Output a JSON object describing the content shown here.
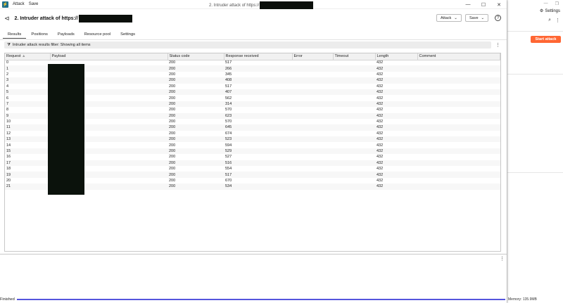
{
  "window": {
    "menu": [
      "Attack",
      "Save"
    ],
    "title_prefix": "2. Intruder attack of https://",
    "controls": [
      "—",
      "☐",
      "✕"
    ]
  },
  "header": {
    "title_prefix": "2. Intruder attack of https://",
    "attack_button": "Attack",
    "save_button": "Save",
    "help": "?"
  },
  "tabs": [
    "Results",
    "Positions",
    "Payloads",
    "Resource pool",
    "Settings"
  ],
  "active_tab": "Results",
  "filter": {
    "label": "Intruder attack results filter: Showing all items"
  },
  "table": {
    "columns": [
      "Request",
      "Payload",
      "Status code",
      "Response received",
      "Error",
      "Timeout",
      "Length",
      "Comment"
    ],
    "sort_indicator": "▲",
    "rows": [
      {
        "request": "0",
        "status": "200",
        "response": "517",
        "length": "432"
      },
      {
        "request": "1",
        "status": "200",
        "response": "266",
        "length": "432"
      },
      {
        "request": "2",
        "status": "200",
        "response": "345",
        "length": "432"
      },
      {
        "request": "3",
        "status": "200",
        "response": "408",
        "length": "432"
      },
      {
        "request": "4",
        "status": "200",
        "response": "517",
        "length": "432"
      },
      {
        "request": "5",
        "status": "200",
        "response": "407",
        "length": "432"
      },
      {
        "request": "6",
        "status": "200",
        "response": "562",
        "length": "432"
      },
      {
        "request": "7",
        "status": "200",
        "response": "314",
        "length": "432"
      },
      {
        "request": "8",
        "status": "200",
        "response": "570",
        "length": "432"
      },
      {
        "request": "9",
        "status": "200",
        "response": "623",
        "length": "432"
      },
      {
        "request": "10",
        "status": "200",
        "response": "570",
        "length": "432"
      },
      {
        "request": "11",
        "status": "200",
        "response": "645",
        "length": "432"
      },
      {
        "request": "12",
        "status": "200",
        "response": "674",
        "length": "432"
      },
      {
        "request": "13",
        "status": "200",
        "response": "523",
        "length": "432"
      },
      {
        "request": "14",
        "status": "200",
        "response": "594",
        "length": "432"
      },
      {
        "request": "15",
        "status": "200",
        "response": "529",
        "length": "432"
      },
      {
        "request": "16",
        "status": "200",
        "response": "527",
        "length": "432"
      },
      {
        "request": "17",
        "status": "200",
        "response": "516",
        "length": "432"
      },
      {
        "request": "18",
        "status": "200",
        "response": "554",
        "length": "432"
      },
      {
        "request": "19",
        "status": "200",
        "response": "517",
        "length": "432"
      },
      {
        "request": "20",
        "status": "200",
        "response": "670",
        "length": "432"
      },
      {
        "request": "21",
        "status": "200",
        "response": "534",
        "length": "432"
      }
    ]
  },
  "status": {
    "text": "Finished",
    "progress": 1.0,
    "progress_color": "#5555dd"
  },
  "background_window": {
    "settings_label": "Settings",
    "start_attack": "Start attack",
    "start_attack_color": "#ff6633",
    "memory": "Memory: 135.9MB"
  }
}
